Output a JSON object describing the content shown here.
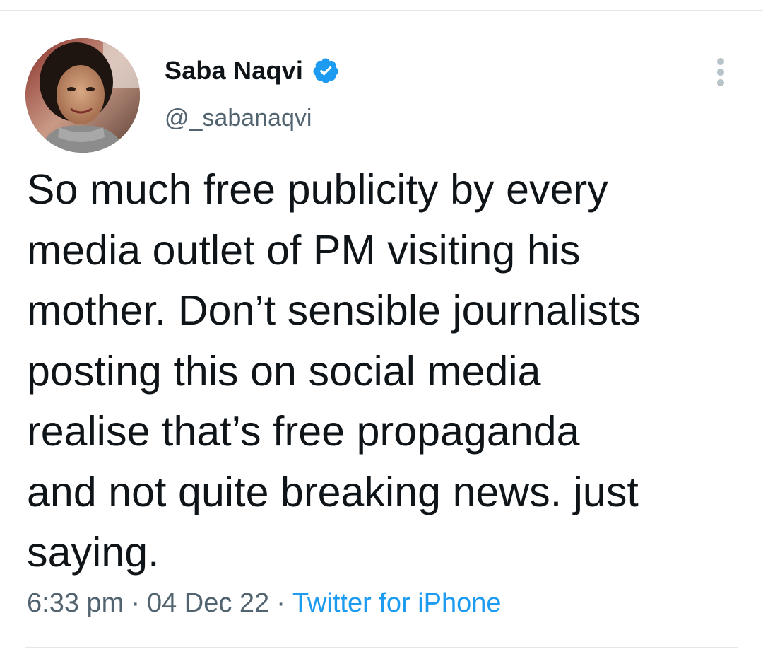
{
  "tweet": {
    "author": {
      "display_name": "Saba Naqvi",
      "handle": "@_sabanaqvi",
      "verified": true
    },
    "text": "So much free publicity by every\nmedia outlet of PM visiting his\nmother. Don’t sensible journalists\nposting this on social media\nrealise that’s free propaganda\nand not quite breaking news. just\nsaying.",
    "time": "6:33 pm",
    "separator": "·",
    "date": "04 Dec 22",
    "source": "Twitter for iPhone"
  },
  "icons": {
    "verified": "verified-badge-icon",
    "more": "more-options-icon"
  },
  "colors": {
    "text_primary": "#0f1419",
    "text_secondary": "#536471",
    "accent_blue": "#1d9bf0",
    "divider": "#e3e7ea"
  }
}
